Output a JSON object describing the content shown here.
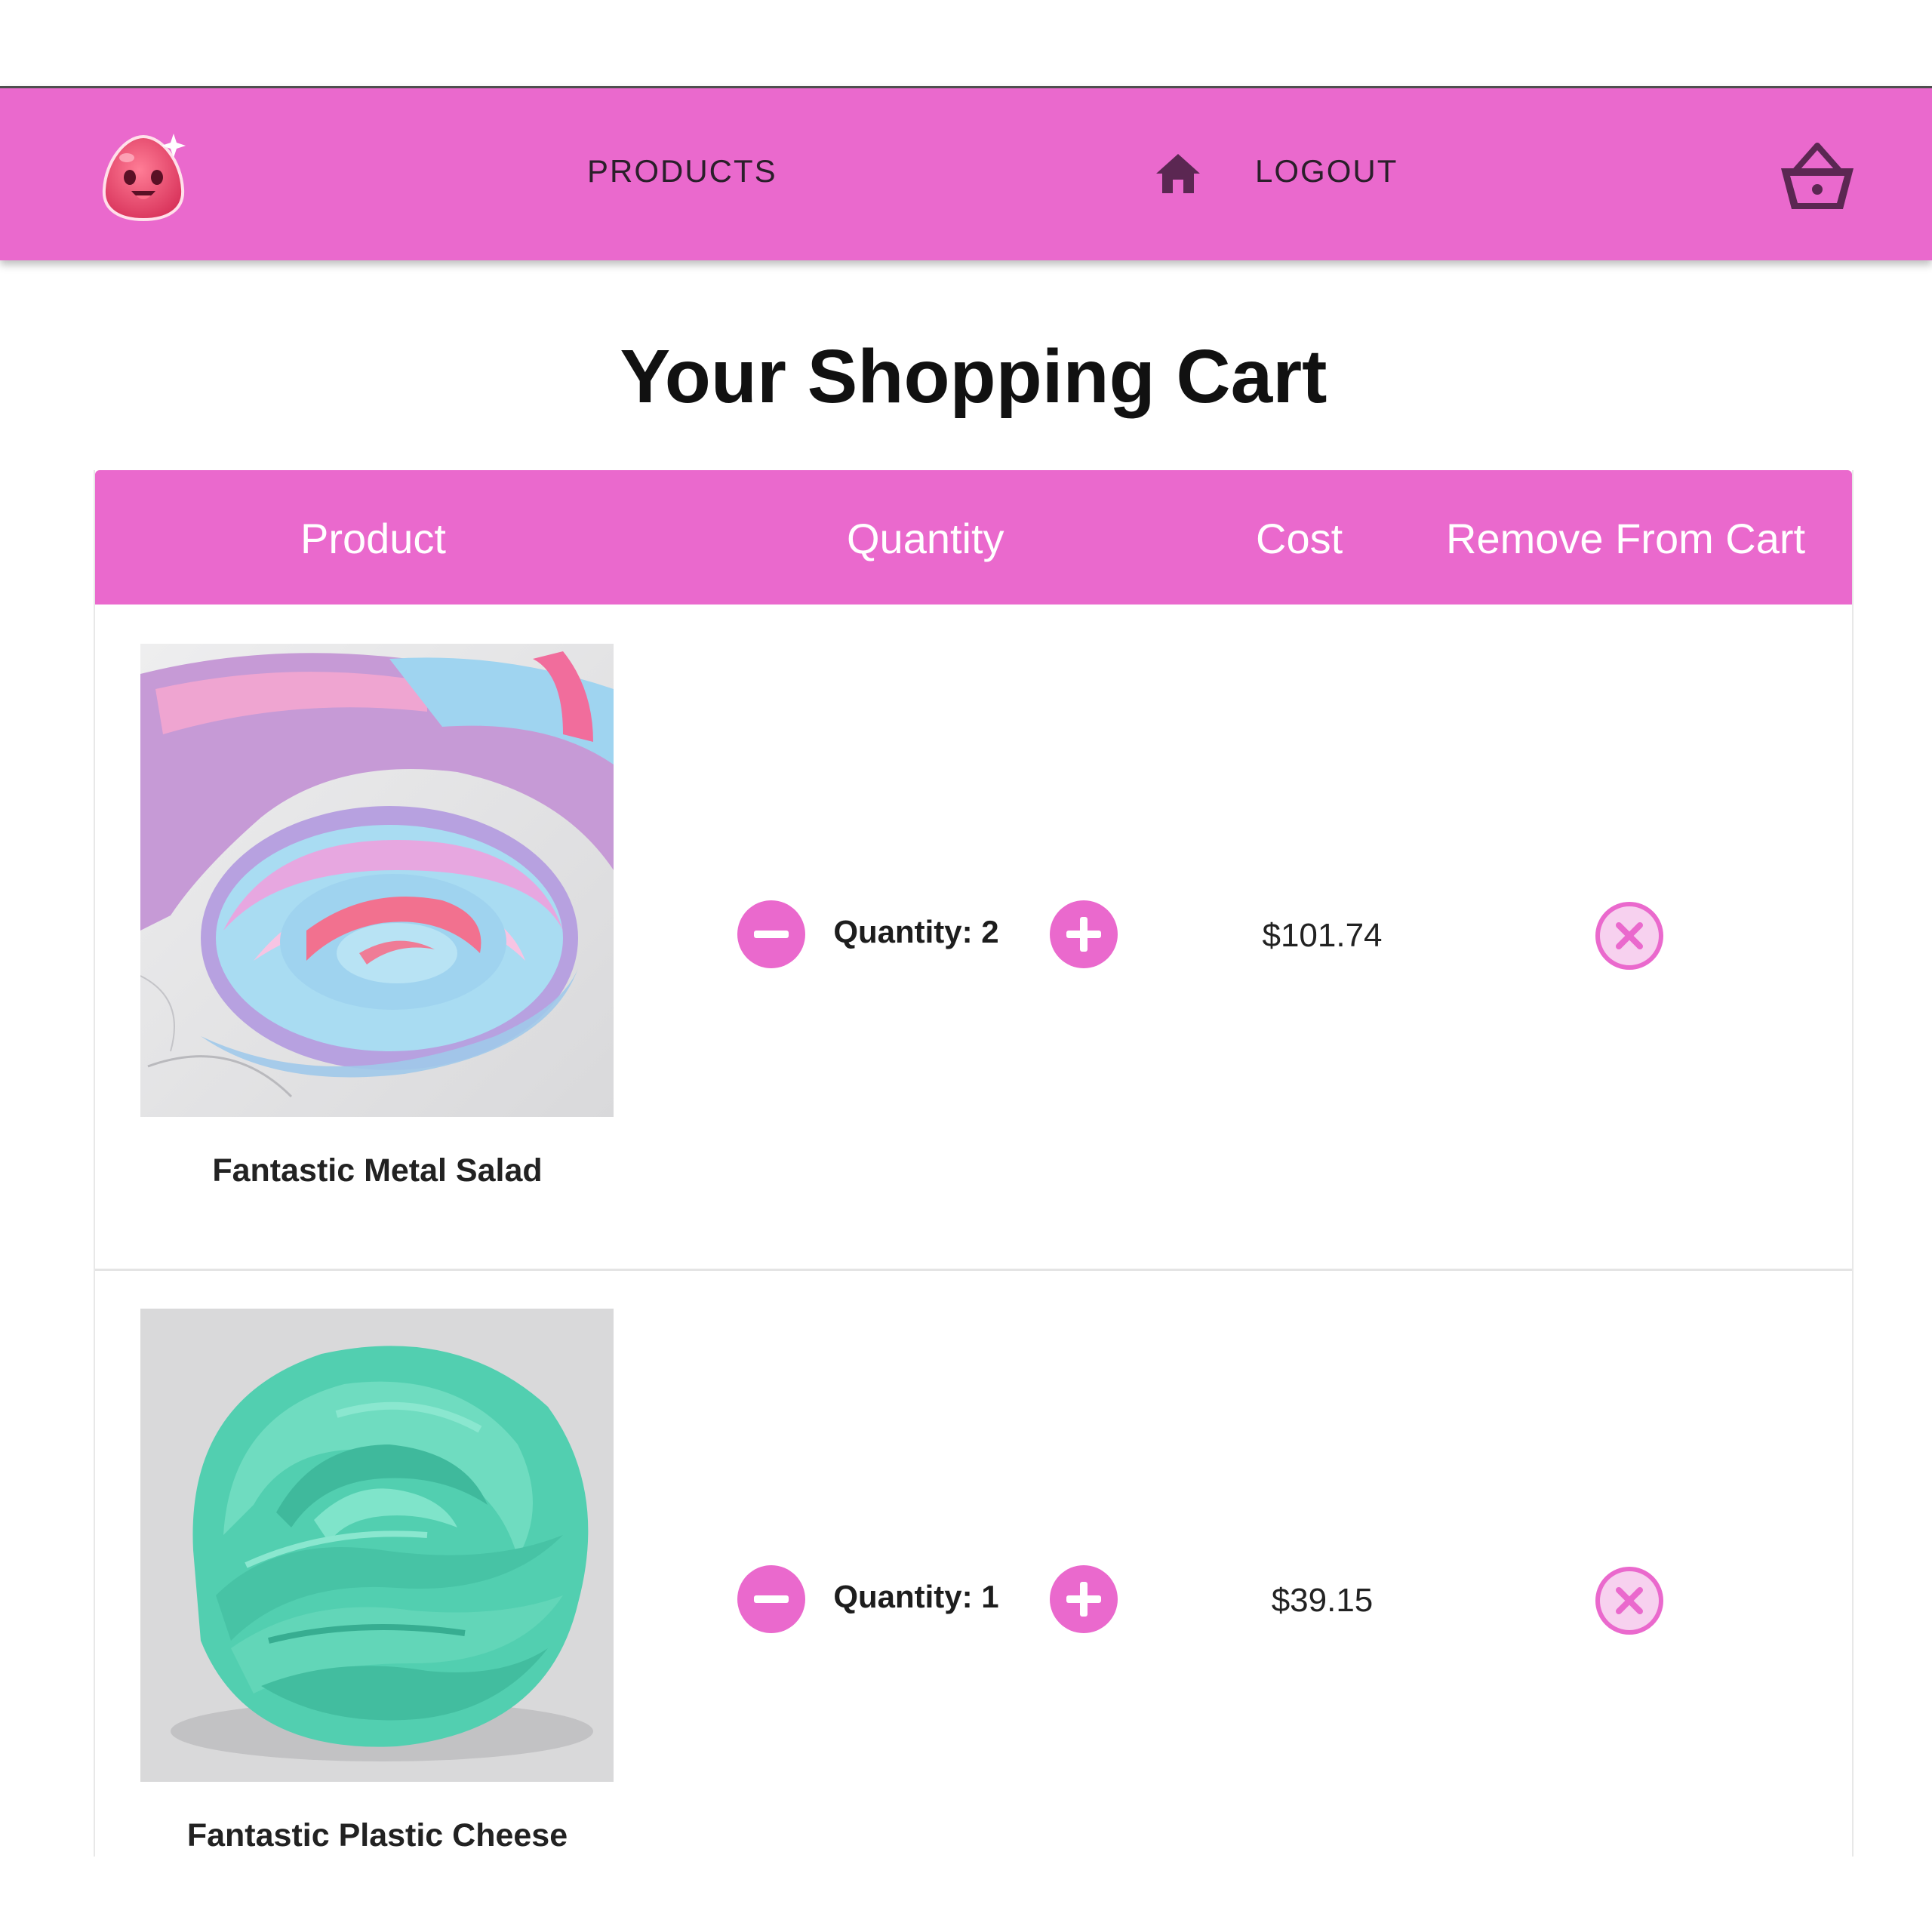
{
  "navbar": {
    "logo": "slime-logo-icon",
    "products_label": "PRODUCTS",
    "home_icon": "home-icon",
    "logout_label": "LOGOUT",
    "cart_icon": "shopping-basket-icon",
    "background": "#ea69cd"
  },
  "page": {
    "title": "Your Shopping Cart"
  },
  "table": {
    "columns": [
      "Product",
      "Quantity",
      "Cost",
      "Remove From Cart"
    ],
    "rows": [
      {
        "product_name": "Fantastic Metal Salad",
        "image": "swirled-pink-blue-purple-slime",
        "quantity_text": "Quantity: 2",
        "cost": "$101.74"
      },
      {
        "product_name": "Fantastic Plastic Cheese",
        "image": "mint-green-slime",
        "quantity_text": "Quantity: 1",
        "cost": "$39.15"
      }
    ]
  },
  "colors": {
    "accent": "#ea69cd",
    "nav_text": "#2a1f2a",
    "remove_fill": "#f7d1ef"
  },
  "icons": {
    "decrease": "minus-circle-icon",
    "increase": "plus-circle-icon",
    "remove": "close-circle-icon"
  }
}
